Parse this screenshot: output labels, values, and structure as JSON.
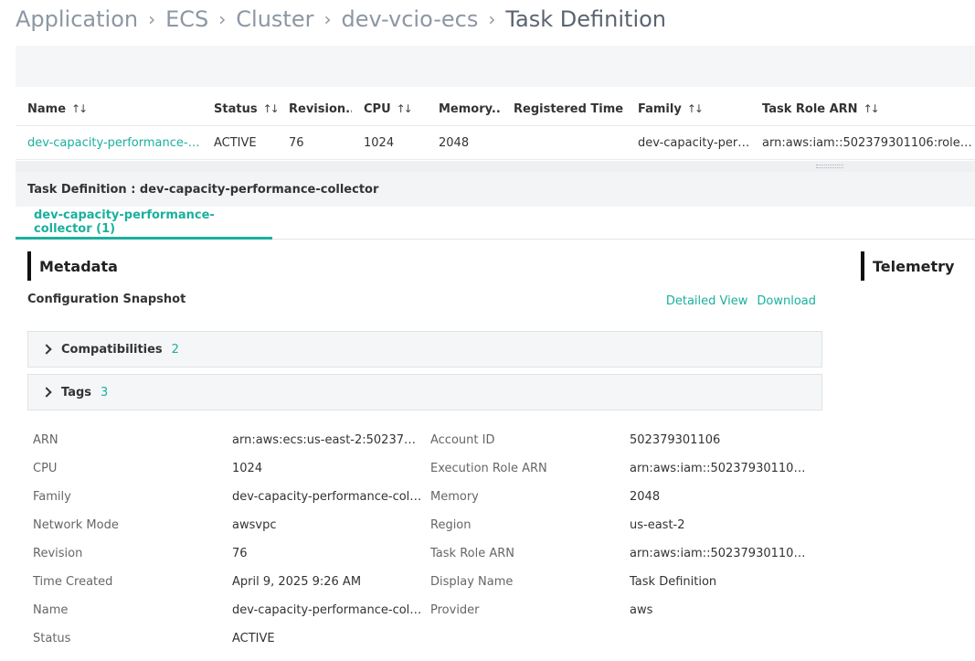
{
  "breadcrumb": [
    "Application",
    "ECS",
    "Cluster",
    "dev-vcio-ecs"
  ],
  "breadcrumb_current": "Task Definition",
  "breadcrumb_separator": "›",
  "table": {
    "columns": [
      "Name",
      "Status",
      "Revision...",
      "CPU",
      "Memory...",
      "Registered Time",
      "Family",
      "Task Role ARN"
    ],
    "sort_icon": "sort-arrows-icon",
    "rows": [
      [
        "dev-capacity-performance-col...",
        "ACTIVE",
        "76",
        "1024",
        "2048",
        "",
        "dev-capacity-perfo...",
        "arn:aws:iam::502379301106:role/dev_c"
      ]
    ]
  },
  "panel": {
    "title": "Task Definition : dev-capacity-performance-collector",
    "tab": "dev-capacity-performance-collector (1)"
  },
  "metadata": {
    "heading": "Metadata",
    "config_label": "Configuration Snapshot",
    "detailed_view": "Detailed View",
    "download": "Download",
    "accordions": [
      {
        "label": "Compatibilities",
        "count": "2"
      },
      {
        "label": "Tags",
        "count": "3"
      }
    ],
    "properties": [
      [
        "ARN",
        "arn:aws:ecs:us-east-2:50237930...",
        "Account ID",
        "502379301106"
      ],
      [
        "CPU",
        "1024",
        "Execution Role ARN",
        "arn:aws:iam::502379301106:rol..."
      ],
      [
        "Family",
        "dev-capacity-performance-colle...",
        "Memory",
        "2048"
      ],
      [
        "Network Mode",
        "awsvpc",
        "Region",
        "us-east-2"
      ],
      [
        "Revision",
        "76",
        "Task Role ARN",
        "arn:aws:iam::502379301106:rol..."
      ],
      [
        "Time Created",
        "April 9, 2025 9:26 AM",
        "Display Name",
        "Task Definition"
      ],
      [
        "Name",
        "dev-capacity-performance-colle...",
        "Provider",
        "aws"
      ],
      [
        "Status",
        "ACTIVE",
        "",
        ""
      ]
    ]
  },
  "telemetry": {
    "heading": "Telemetry"
  },
  "colors": {
    "accent": "#1ab09e",
    "band": "#f5f6f8"
  }
}
